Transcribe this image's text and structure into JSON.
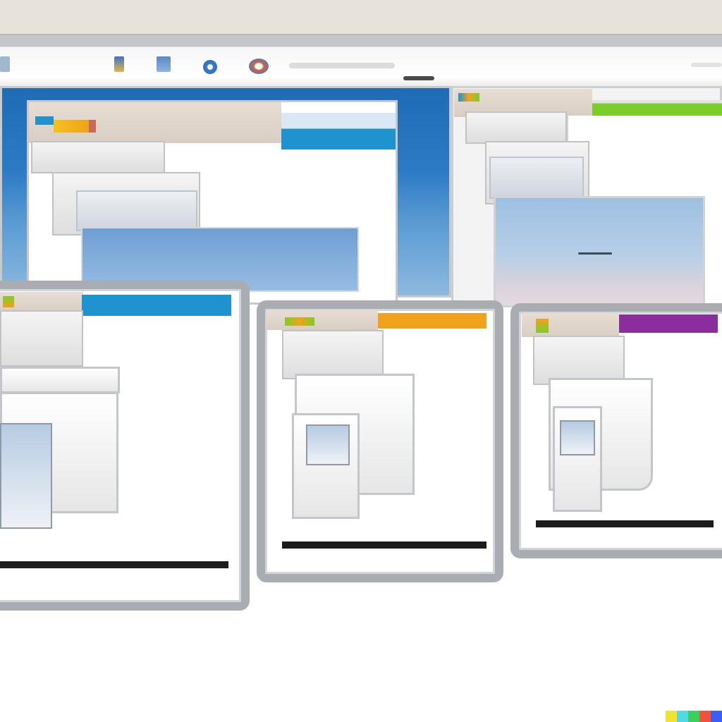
{
  "colors": {
    "desktop_sky_blue": "#2c7bc4",
    "tab_blue": "#1e93cf",
    "tab_green": "#7ccd2b",
    "tab_orange": "#f0a21c",
    "tab_purple": "#8b2d9c",
    "frame_grey": "#a9adb2",
    "titlebar_beige": "#e0d5cb"
  },
  "toolbar": {
    "icons": [
      "app-icon",
      "app-icon",
      "document-icon",
      "globe-icon",
      "browser-icon"
    ]
  },
  "windows": [
    {
      "name": "main-window",
      "accent": "#2c7bc4"
    },
    {
      "name": "right-window",
      "accent": "#7ccd2b"
    },
    {
      "name": "bottom-left-window",
      "accent": "#1e93cf"
    },
    {
      "name": "bottom-middle-window",
      "accent": "#f0a21c"
    },
    {
      "name": "bottom-right-window",
      "accent": "#8b2d9c"
    }
  ],
  "brand_strip": [
    "#f2e232",
    "#53d9e6",
    "#3ccf5c",
    "#f2513d",
    "#3c5ff2"
  ]
}
